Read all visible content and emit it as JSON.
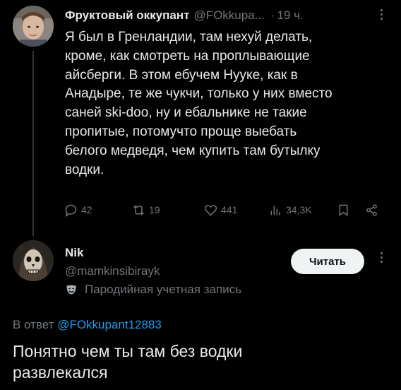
{
  "tweet": {
    "author_name": "Фруктовый оккупант",
    "author_handle": "@FOkkupa...",
    "separator": "·",
    "time": "19 ч.",
    "text_lines": [
      "Я был в Гренландии, там нехуй делать,",
      "кроме, как смотреть на проплывающие",
      "айсберги. В этом ебучем Нууке, как в",
      "Анадыре, те же чукчи, только у них вместо",
      "саней ski-doo, ну и ебальнике не такие",
      "пропитые, потомучто проще выебать",
      "белого медведя, чем купить там бутылку",
      "водки."
    ],
    "actions": {
      "replies": "42",
      "reposts": "19",
      "likes": "441",
      "views": "34,3K"
    }
  },
  "reply": {
    "author_name": "Nik",
    "author_handle": "@mamkinsibirayk",
    "parody_label": "Пародийная учетная запись",
    "follow_label": "Читать",
    "reply_to_prefix": "В ответ",
    "reply_to_handle": "@FOkkupant12883",
    "text_lines": [
      "Понятно чем ты там без водки",
      "развлекался"
    ]
  },
  "icons": {
    "reply": "comment-icon",
    "repost": "repost-icon",
    "like": "heart-icon",
    "views": "views-icon",
    "bookmark": "bookmark-icon",
    "share": "share-icon",
    "parody": "parody-mask-icon",
    "more": "more-icon"
  },
  "colors": {
    "background": "#000000",
    "text": "#e7e9ea",
    "secondary": "#71767b",
    "link": "#1d9bf0",
    "button_bg": "#eff3f4"
  }
}
